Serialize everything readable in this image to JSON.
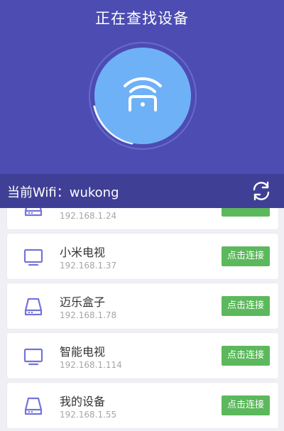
{
  "header": {
    "title": "正在查找设备"
  },
  "wifi": {
    "label": "当前Wifi：wukong"
  },
  "devices": [
    {
      "name": "",
      "ip": "192.168.1.24",
      "type": "box",
      "button": ""
    },
    {
      "name": "小米电视",
      "ip": "192.168.1.37",
      "type": "tv",
      "button": "点击连接"
    },
    {
      "name": "迈乐盒子",
      "ip": "192.168.1.78",
      "type": "box",
      "button": "点击连接"
    },
    {
      "name": "智能电视",
      "ip": "192.168.1.114",
      "type": "tv",
      "button": "点击连接"
    },
    {
      "name": "我的设备",
      "ip": "192.168.1.55",
      "type": "box",
      "button": "点击连接"
    }
  ],
  "colors": {
    "header_bg": "#4c4cb3",
    "wifi_bar_bg": "#3f3f96",
    "radar_fill": "#6fb1f7",
    "button_green": "#5cb85c",
    "icon_purple": "#7474d6"
  },
  "icons": {
    "radar": "wifi-signal-icon",
    "refresh": "refresh-icon",
    "tv": "tv-icon",
    "box": "storage-box-icon"
  }
}
